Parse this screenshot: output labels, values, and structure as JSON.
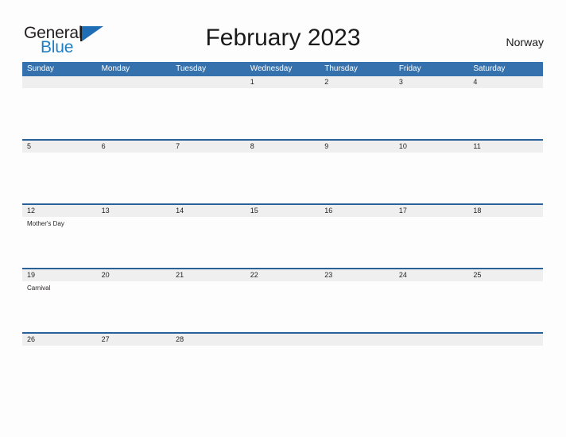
{
  "brand": {
    "word_one": "General",
    "word_two": "Blue",
    "flag_icon": "blue-flag-icon",
    "colors": {
      "general": "#231f20",
      "blue": "#1f7fc4",
      "flag": "#1f6db5"
    }
  },
  "header": {
    "title": "February 2023",
    "country": "Norway"
  },
  "calendar": {
    "colors": {
      "weekday_header_bg": "#3572ad",
      "weekday_header_text": "#ffffff",
      "week_divider": "#2a6199",
      "date_band_bg": "#efefef",
      "date_text": "#231f20",
      "page_bg": "#fdfdfd"
    },
    "weekdays": [
      "Sunday",
      "Monday",
      "Tuesday",
      "Wednesday",
      "Thursday",
      "Friday",
      "Saturday"
    ],
    "weeks": [
      {
        "days": [
          {
            "date": "",
            "events": []
          },
          {
            "date": "",
            "events": []
          },
          {
            "date": "",
            "events": []
          },
          {
            "date": "1",
            "events": []
          },
          {
            "date": "2",
            "events": []
          },
          {
            "date": "3",
            "events": []
          },
          {
            "date": "4",
            "events": []
          }
        ]
      },
      {
        "days": [
          {
            "date": "5",
            "events": []
          },
          {
            "date": "6",
            "events": []
          },
          {
            "date": "7",
            "events": []
          },
          {
            "date": "8",
            "events": []
          },
          {
            "date": "9",
            "events": []
          },
          {
            "date": "10",
            "events": []
          },
          {
            "date": "11",
            "events": []
          }
        ]
      },
      {
        "days": [
          {
            "date": "12",
            "events": [
              "Mother's Day"
            ]
          },
          {
            "date": "13",
            "events": []
          },
          {
            "date": "14",
            "events": []
          },
          {
            "date": "15",
            "events": []
          },
          {
            "date": "16",
            "events": []
          },
          {
            "date": "17",
            "events": []
          },
          {
            "date": "18",
            "events": []
          }
        ]
      },
      {
        "days": [
          {
            "date": "19",
            "events": [
              "Carnival"
            ]
          },
          {
            "date": "20",
            "events": []
          },
          {
            "date": "21",
            "events": []
          },
          {
            "date": "22",
            "events": []
          },
          {
            "date": "23",
            "events": []
          },
          {
            "date": "24",
            "events": []
          },
          {
            "date": "25",
            "events": []
          }
        ]
      },
      {
        "days": [
          {
            "date": "26",
            "events": []
          },
          {
            "date": "27",
            "events": []
          },
          {
            "date": "28",
            "events": []
          },
          {
            "date": "",
            "events": []
          },
          {
            "date": "",
            "events": []
          },
          {
            "date": "",
            "events": []
          },
          {
            "date": "",
            "events": []
          }
        ]
      }
    ]
  }
}
